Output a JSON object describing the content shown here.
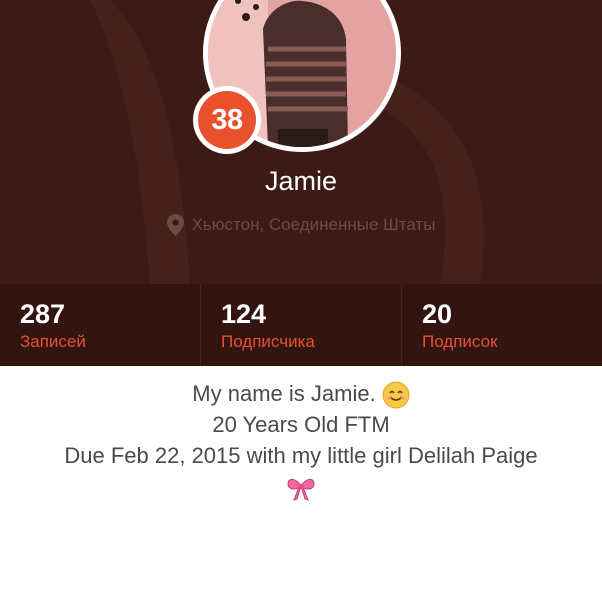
{
  "profile": {
    "name": "Jamie",
    "age_badge": "38",
    "location": "Хьюстон, Соединенные Штаты"
  },
  "stats": [
    {
      "value": "287",
      "label": "Записей"
    },
    {
      "value": "124",
      "label": "Подписчика"
    },
    {
      "value": "20",
      "label": "Подписок"
    }
  ],
  "bio": {
    "line1": "My name is Jamie.",
    "line2": "20 Years Old FTM",
    "line3": "Due Feb 22, 2015 with my little girl Delilah Paige"
  },
  "colors": {
    "header_bg": "#3d1a15",
    "stats_bg": "#321511",
    "accent": "#e8502e"
  },
  "icons": {
    "location": "location-pin-icon",
    "smile": "smiling-face-emoji",
    "bow": "pink-ribbon-bow-emoji"
  }
}
